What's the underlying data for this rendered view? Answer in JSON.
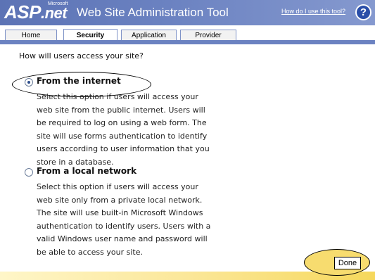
{
  "header": {
    "logo_main": "ASP",
    "logo_net": ".net",
    "logo_ms": "Microsoft",
    "title": "Web Site Administration Tool",
    "help_link": "How do I use this tool?",
    "help_icon": "question-icon"
  },
  "tabs": [
    {
      "label": "Home",
      "active": false
    },
    {
      "label": "Security",
      "active": true
    },
    {
      "label": "Application",
      "active": false
    },
    {
      "label": "Provider",
      "active": false
    }
  ],
  "main": {
    "question": "How will users access your site?",
    "options": [
      {
        "label": "From the internet",
        "selected": true,
        "description": [
          "Select this option if users will access your",
          "web site from the public internet. Users will",
          "be required to log on using a web form. The",
          "site will use forms authentication to identify",
          "users according to user information that you",
          "store in a database."
        ]
      },
      {
        "label": "From a local network",
        "selected": false,
        "description": [
          "Select this option if users will access your",
          "web site only from a private local network.",
          "The site will use built-in Microsoft Windows",
          "authentication to identify users. Users with a",
          "valid Windows user name and password will",
          "be able to access your site."
        ]
      }
    ],
    "done_label": "Done"
  },
  "colors": {
    "header": "#6b82c1",
    "highlight": "#f7dc6f"
  }
}
